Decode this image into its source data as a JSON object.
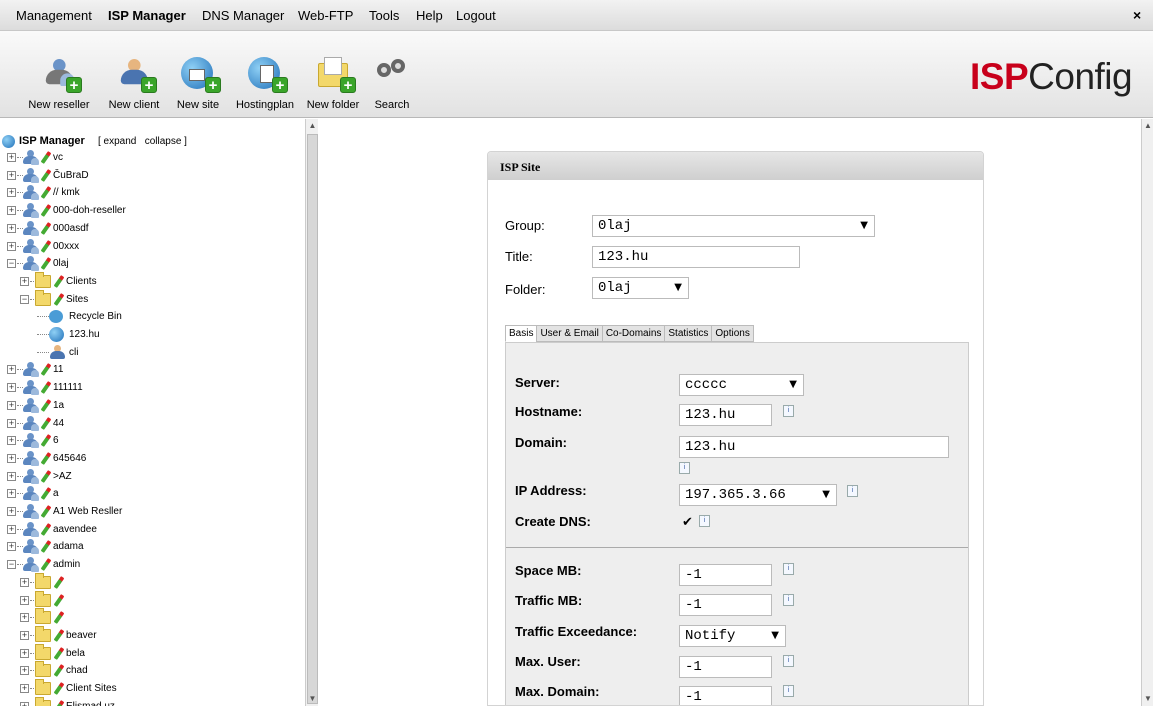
{
  "menu": {
    "items": [
      "Management",
      "ISP Manager",
      "DNS Manager",
      "Web-FTP",
      "Tools",
      "Help",
      "Logout"
    ],
    "close": "×"
  },
  "toolbar": {
    "buttons": [
      "New reseller",
      "New client",
      "New site",
      "Hostingplan",
      "New folder",
      "Search"
    ],
    "logo_isp": "ISP",
    "logo_config": "Config"
  },
  "tree": {
    "root": "ISP Manager",
    "expand_collapse": "[ expand   collapse ]",
    "nodes": [
      "vc",
      "ČuBraD",
      "// kmk",
      "000-doh-reseller",
      "000asdf",
      "00xxx",
      "0laj",
      "Clients",
      "Sites",
      "Recycle Bin",
      "123.hu",
      "cli",
      "11",
      "111111",
      "1a",
      "44",
      "6",
      "645646",
      ">AZ",
      "a",
      "A1 Web Resller",
      "aavendee",
      "adama",
      "admin",
      "",
      "",
      "",
      "beaver",
      "bela",
      "chad",
      "Client Sites",
      "Elismad uz"
    ]
  },
  "panel": {
    "title": "ISP Site",
    "group_label": "Group:",
    "group_value": "0laj",
    "title_label": "Title:",
    "title_value": "123.hu",
    "folder_label": "Folder:",
    "folder_value": "0laj",
    "tabs": [
      "Basis",
      "User & Email",
      "Co-Domains",
      "Statistics",
      "Options"
    ],
    "fields": {
      "server_label": "Server:",
      "server_value": "ccccc",
      "hostname_label": "Hostname:",
      "hostname_value": "123.hu",
      "domain_label": "Domain:",
      "domain_value": "123.hu",
      "ip_label": "IP Address:",
      "ip_value": "197.365.3.66",
      "dns_label": "Create DNS:",
      "dns_checked": "✔",
      "space_label": "Space MB:",
      "space_value": "-1",
      "traffic_label": "Traffic MB:",
      "traffic_value": "-1",
      "exceed_label": "Traffic Exceedance:",
      "exceed_value": "Notify",
      "maxuser_label": "Max. User:",
      "maxuser_value": "-1",
      "maxdomain_label": "Max. Domain:",
      "maxdomain_value": "-1"
    }
  }
}
